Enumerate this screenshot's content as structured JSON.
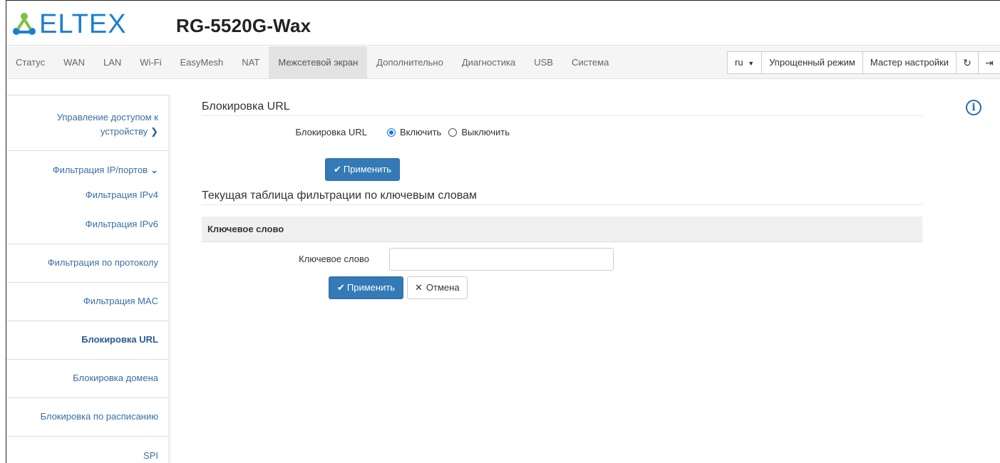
{
  "header": {
    "logo_text": "ELTEX",
    "model": "RG-5520G-Wax"
  },
  "nav": {
    "items": [
      {
        "label": "Статус"
      },
      {
        "label": "WAN"
      },
      {
        "label": "LAN"
      },
      {
        "label": "Wi-Fi"
      },
      {
        "label": "EasyMesh"
      },
      {
        "label": "NAT"
      },
      {
        "label": "Межсетевой экран",
        "active": true
      },
      {
        "label": "Дополнительно"
      },
      {
        "label": "Диагностика"
      },
      {
        "label": "USB"
      },
      {
        "label": "Система"
      }
    ],
    "lang": "ru",
    "simple_mode": "Упрощенный режим",
    "wizard": "Мастер настройки"
  },
  "sidebar": {
    "items": [
      {
        "label_line1": "Управление доступом к",
        "label_line2": "устройству"
      },
      {
        "label": "Фильтрация IP/портов"
      },
      {
        "label": "Фильтрация IPv4"
      },
      {
        "label": "Фильтрация IPv6"
      },
      {
        "label": "Фильтрация по протоколу"
      },
      {
        "label": "Фильтрация MAC"
      },
      {
        "label": "Блокировка URL",
        "active": true
      },
      {
        "label": "Блокировка домена"
      },
      {
        "label": "Блокировка по расписанию"
      },
      {
        "label": "SPI"
      }
    ]
  },
  "main": {
    "section1_title": "Блокировка URL",
    "url_block_label": "Блокировка URL",
    "radio_on": "Включить",
    "radio_off": "Выключить",
    "radio_selected": "Включить",
    "apply1": "Применить",
    "section2_title": "Текущая таблица фильтрации по ключевым словам",
    "table_header": "Ключевое слово",
    "keyword_label": "Ключевое слово",
    "keyword_value": "",
    "apply2": "Применить",
    "cancel": "Отмена"
  },
  "colors": {
    "brand": "#1a7fd4",
    "primary_button": "#337ab7",
    "sidebar_link": "#3a6ea5"
  },
  "icons": [
    "eltex-logo-icon",
    "chevron-down-icon",
    "refresh-icon",
    "logout-icon",
    "info-icon",
    "check-icon",
    "close-icon",
    "chevron-right-icon"
  ]
}
